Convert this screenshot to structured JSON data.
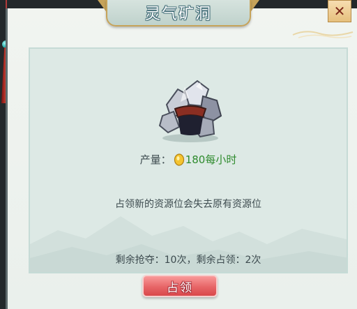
{
  "dialog": {
    "title": "灵气矿洞",
    "close_icon": "close-icon",
    "ore_icon": "spirit-ore-mine-icon",
    "yield": {
      "label": "产量：",
      "currency_icon": "gold-coin-icon",
      "value": "180每小时"
    },
    "notice": "占领新的资源位会失去原有资源位",
    "remaining": "剩余抢夺：10次，剩余占领：2次",
    "occupy_button": "占领"
  },
  "colors": {
    "title_plate": "#bfd2cc",
    "panel": "#dde9e5",
    "yield_value": "#2d8a2c",
    "button": "#e76567",
    "accent_gold": "#c6a35a"
  }
}
